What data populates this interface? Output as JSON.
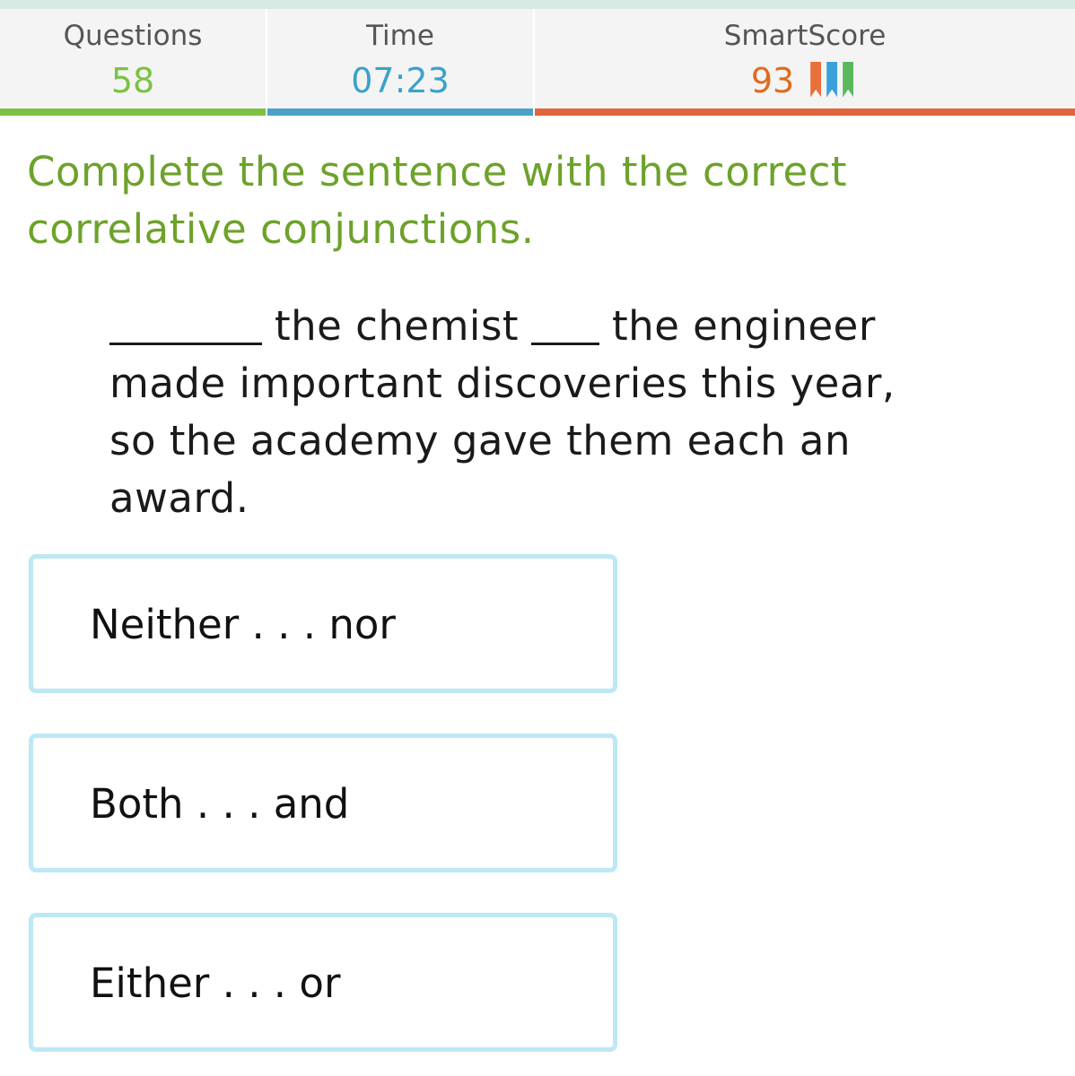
{
  "stats": {
    "questions": {
      "label": "Questions",
      "value": "58",
      "color": "#7dc143"
    },
    "time": {
      "label": "Time",
      "value": "07:23",
      "color": "#3aa2c9"
    },
    "smartscore": {
      "label": "SmartScore",
      "value": "93",
      "color": "#e06b1e",
      "ribbon_colors": [
        "#e8703a",
        "#3aa2d9",
        "#5cb85c"
      ]
    }
  },
  "question": {
    "instruction": "Complete the sentence with the correct correlative conjunctions.",
    "sentence_part_1": "the chemist",
    "sentence_part_2": "the engineer made important discoveries this year, so the academy gave them each an award."
  },
  "options": [
    {
      "label": "Neither . . . nor"
    },
    {
      "label": "Both . . . and"
    },
    {
      "label": "Either . . . or"
    }
  ],
  "colors": {
    "option_border": "#bde8f5",
    "instruction": "#6da22b"
  }
}
